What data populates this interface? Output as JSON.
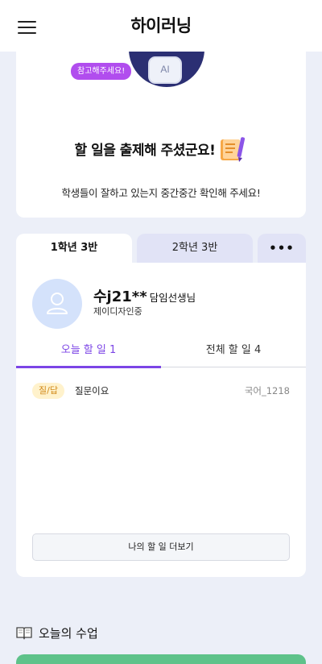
{
  "header": {
    "app_title": "하이러닝"
  },
  "intro": {
    "speech_bubble": "참고해주세요!",
    "robot_label": "AI",
    "headline": "할 일을 출제해 주셨군요!",
    "subtext": "학생들이 잘하고 있는지 중간중간 확인해 주세요!"
  },
  "class_tabs": {
    "items": [
      {
        "label": "1학년 3반"
      },
      {
        "label": "2학년 3반"
      }
    ],
    "more_label": "•••"
  },
  "teacher": {
    "name": "수j21**",
    "role": "담임선생님",
    "org": "제이디자인중"
  },
  "subtabs": {
    "today": "오늘 할 일 1",
    "all": "전체 할 일 4"
  },
  "tasks": [
    {
      "badge": "질/답",
      "title": "질문이요",
      "code": "국어_1218"
    }
  ],
  "more_button": "나의 할 일 더보기",
  "section": {
    "title": "오늘의 수업"
  },
  "colors": {
    "accent": "#7c45e6",
    "background": "#eceff8",
    "badge_bg": "#fff2cc",
    "badge_fg": "#d28a1a",
    "speech_bg": "#b14dee",
    "green_card": "#5ec28a"
  },
  "icons": [
    "menu-icon",
    "robot-icon",
    "book-pencil-icon",
    "user-icon",
    "open-book-icon"
  ]
}
